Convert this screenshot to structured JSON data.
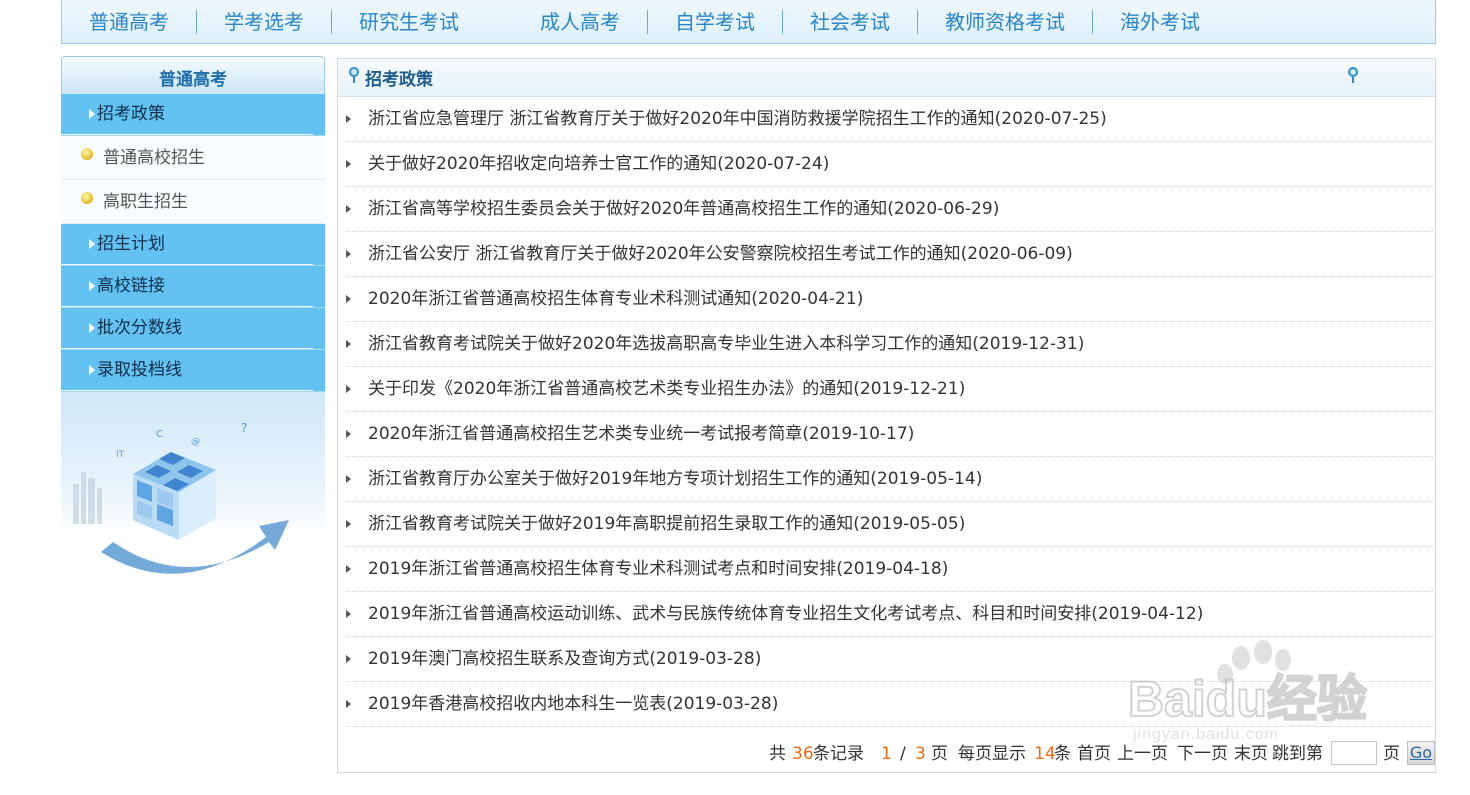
{
  "topnav": {
    "items": [
      "普通高考",
      "学考选考",
      "研究生考试",
      "成人高考",
      "自学考试",
      "社会考试",
      "教师资格考试",
      "海外考试"
    ]
  },
  "sidebar": {
    "title": "普通高考",
    "cat_policy": "招考政策",
    "sub_1": "普通高校招生",
    "sub_2": "高职生招生",
    "cat_plan": "招生计划",
    "cat_links": "高校链接",
    "cat_scores": "批次分数线",
    "cat_admission": "录取投档线"
  },
  "main": {
    "title": "招考政策",
    "news": [
      "浙江省应急管理厅 浙江省教育厅关于做好2020年中国消防救援学院招生工作的通知(2020-07-25)",
      "关于做好2020年招收定向培养士官工作的通知(2020-07-24)",
      "浙江省高等学校招生委员会关于做好2020年普通高校招生工作的通知(2020-06-29)",
      "浙江省公安厅 浙江省教育厅关于做好2020年公安警察院校招生考试工作的通知(2020-06-09)",
      "2020年浙江省普通高校招生体育专业术科测试通知(2020-04-21)",
      "浙江省教育考试院关于做好2020年选拔高职高专毕业生进入本科学习工作的通知(2019-12-31)",
      "关于印发《2020年浙江省普通高校艺术类专业招生办法》的通知(2019-12-21)",
      "2020年浙江省普通高校招生艺术类专业统一考试报考简章(2019-10-17)",
      "浙江省教育厅办公室关于做好2019年地方专项计划招生工作的通知(2019-05-14)",
      "浙江省教育考试院关于做好2019年高职提前招生录取工作的通知(2019-05-05)",
      "2019年浙江省普通高校招生体育专业术科测试考点和时间安排(2019-04-18)",
      "2019年浙江省普通高校运动训练、武术与民族传统体育专业招生文化考试考点、科目和时间安排(2019-04-12)",
      "2019年澳门高校招生联系及查询方式(2019-03-28)",
      "2019年香港高校招收内地本科生一览表(2019-03-28)"
    ]
  },
  "pager": {
    "total_prefix": "共",
    "total": "36",
    "total_suffix": "条记录",
    "current": "1",
    "slash": "/",
    "pages": "3",
    "pages_suffix": "页",
    "per_page_prefix": "每页显示",
    "per_page": "14",
    "per_page_suffix": "条",
    "first": "首页",
    "prev": "上一页",
    "next": "下一页",
    "last": "末页",
    "jump_prefix": "跳到第",
    "jump_suffix": "页",
    "go": "Go"
  },
  "watermark": {
    "brand": "Baidu经验",
    "url": "jingyan.baidu.com"
  }
}
